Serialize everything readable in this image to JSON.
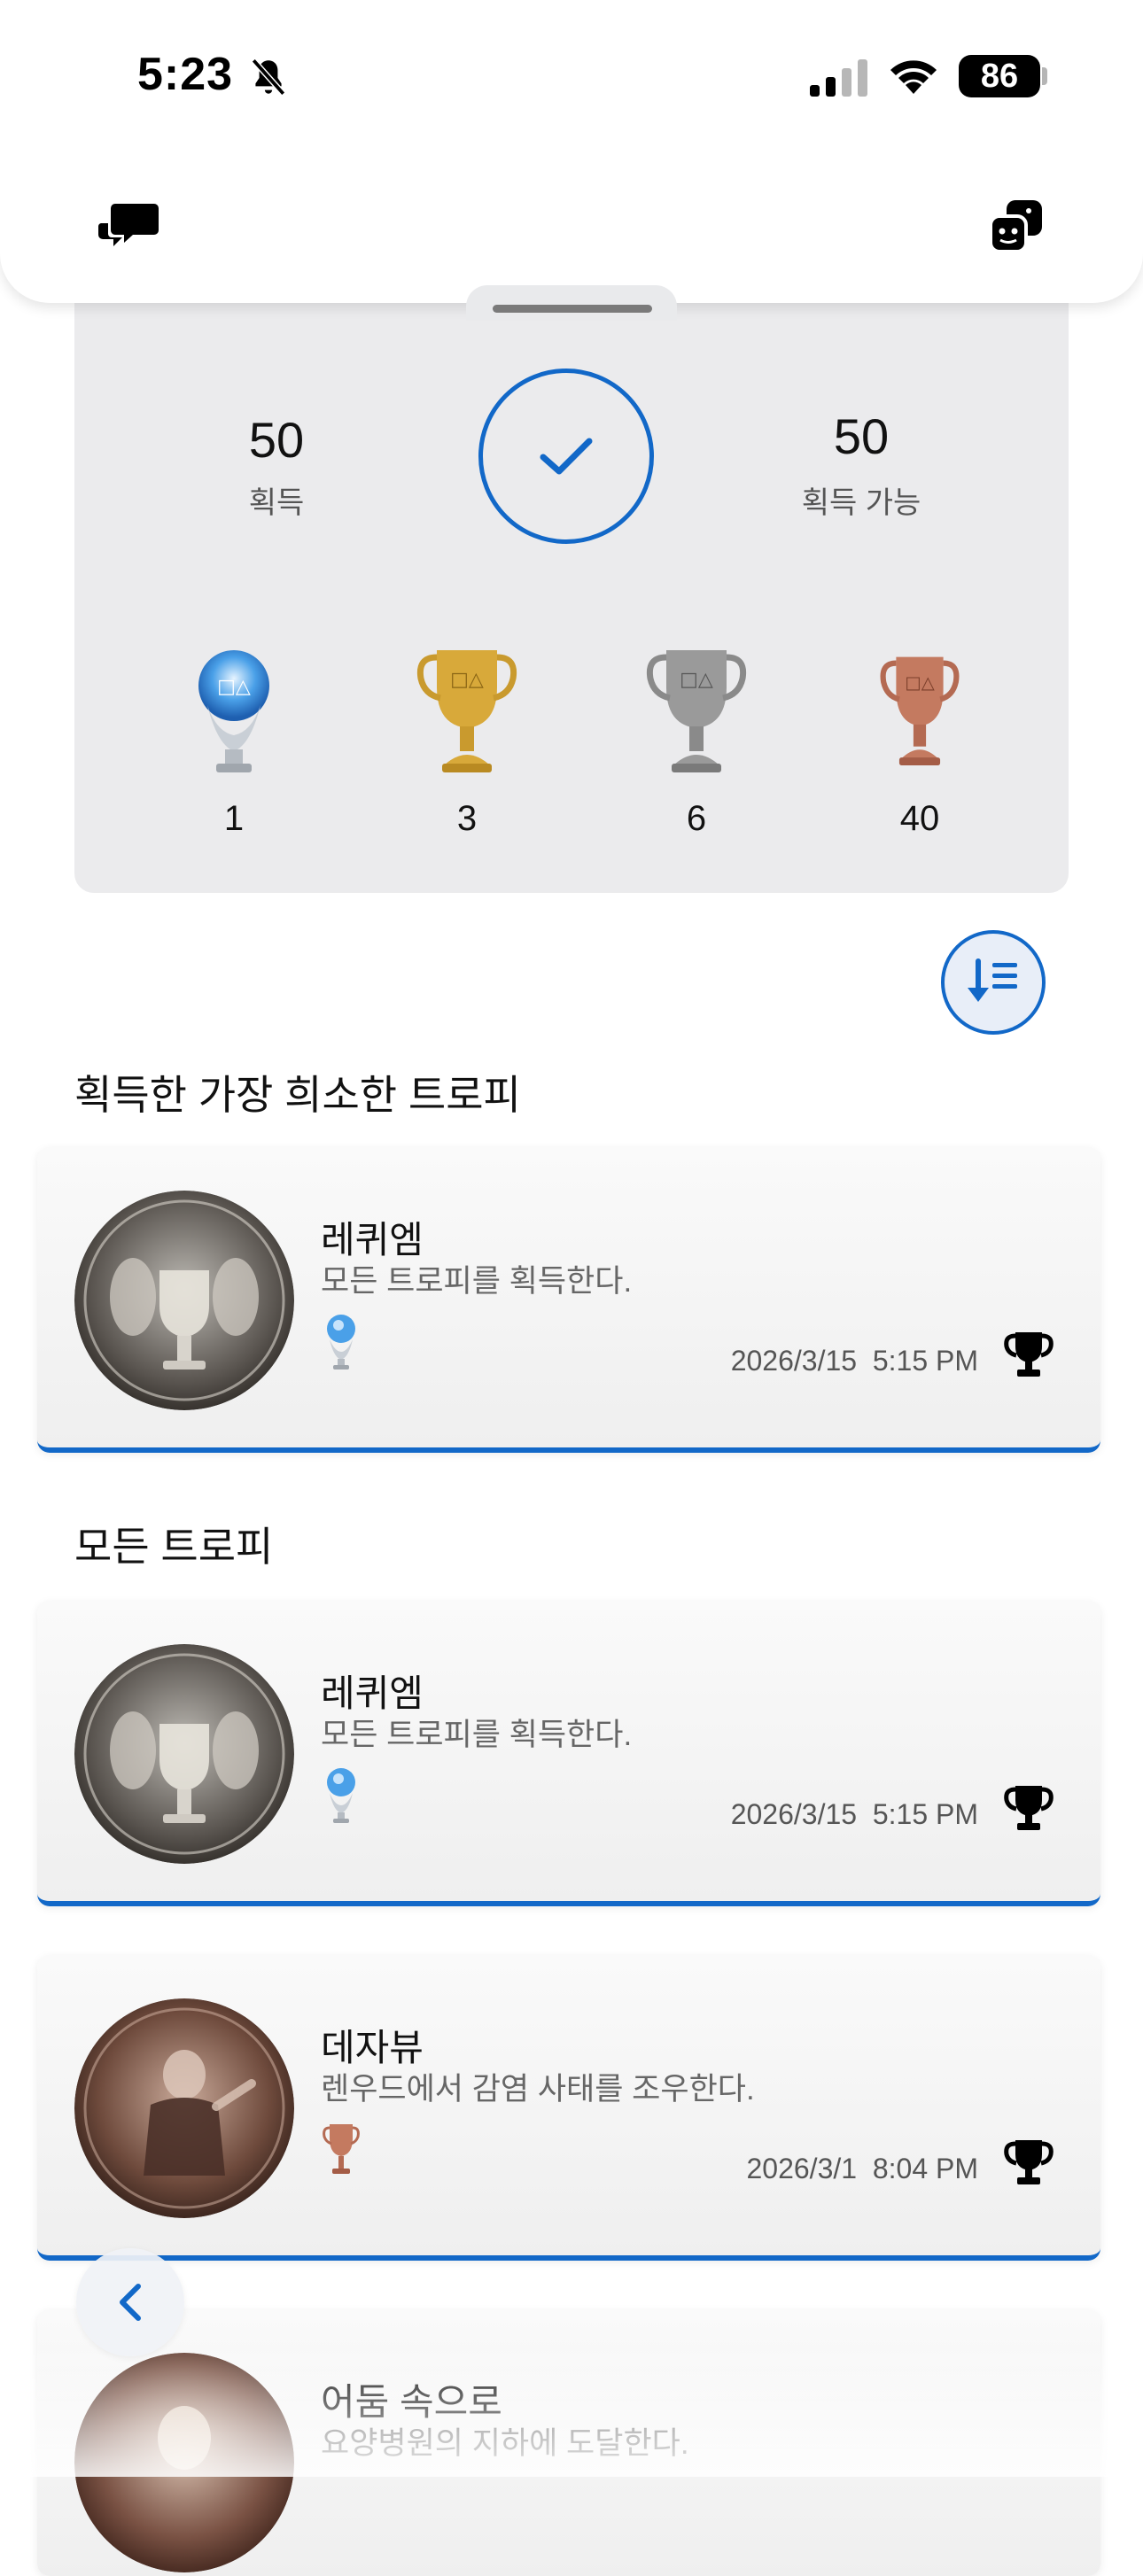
{
  "status_bar": {
    "time": "5:23",
    "battery": "86"
  },
  "summary": {
    "earned_count": "50",
    "earned_label": "획득",
    "available_count": "50",
    "available_label": "획득 가능",
    "completion_icon": "check-icon",
    "tiers": [
      {
        "name": "platinum",
        "count": "1",
        "color": "#9ec8e8"
      },
      {
        "name": "gold",
        "count": "3",
        "color": "#d8a93a"
      },
      {
        "name": "silver",
        "count": "6",
        "color": "#9a9a9a"
      },
      {
        "name": "bronze",
        "count": "40",
        "color": "#c47a60"
      }
    ]
  },
  "colors": {
    "accent": "#1268c8",
    "card_background": "#ebebed"
  },
  "sections": {
    "rarest_title": "획득한 가장 희소한 트로피",
    "all_title": "모든 트로피"
  },
  "rarest": {
    "name": "레퀴엠",
    "description": "모든 트로피를 획득한다.",
    "grade": "platinum",
    "date": "2026/3/15  5:15 PM"
  },
  "trophies": [
    {
      "name": "레퀴엠",
      "description": "모든 트로피를 획득한다.",
      "grade": "platinum",
      "date": "2026/3/15  5:15 PM"
    },
    {
      "name": "데자뷰",
      "description": "렌우드에서 감염 사태를 조우한다.",
      "grade": "bronze",
      "date": "2026/3/1  8:04 PM"
    },
    {
      "name": "어둠 속으로",
      "description": "요양병원의 지하에 도달한다.",
      "grade": "bronze",
      "date": ""
    }
  ]
}
